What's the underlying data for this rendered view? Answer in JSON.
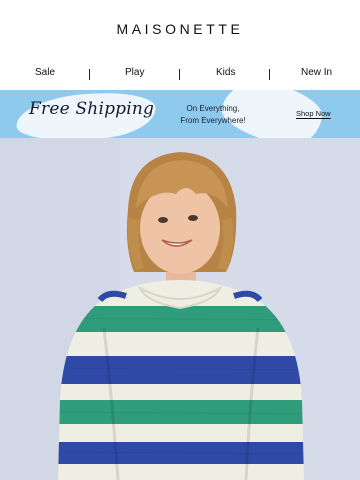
{
  "brand": {
    "logo_text": "MAISONETTE"
  },
  "nav": {
    "items": [
      {
        "label": "Sale"
      },
      {
        "label": "Play"
      },
      {
        "label": "Kids"
      },
      {
        "label": "New In"
      }
    ]
  },
  "promo": {
    "headline": "Free Shipping",
    "subtext_line1": "On Everything,",
    "subtext_line2": "From Everywhere!",
    "cta": "Shop Now",
    "colors": {
      "banner": "#8ecaee",
      "splash": "#f3f8fc"
    }
  },
  "hero": {
    "colors": {
      "background": "#d6dbe9",
      "stripe_blue": "#2f4aa6",
      "stripe_green": "#2f9c7c",
      "stripe_cream": "#efeee2"
    }
  }
}
